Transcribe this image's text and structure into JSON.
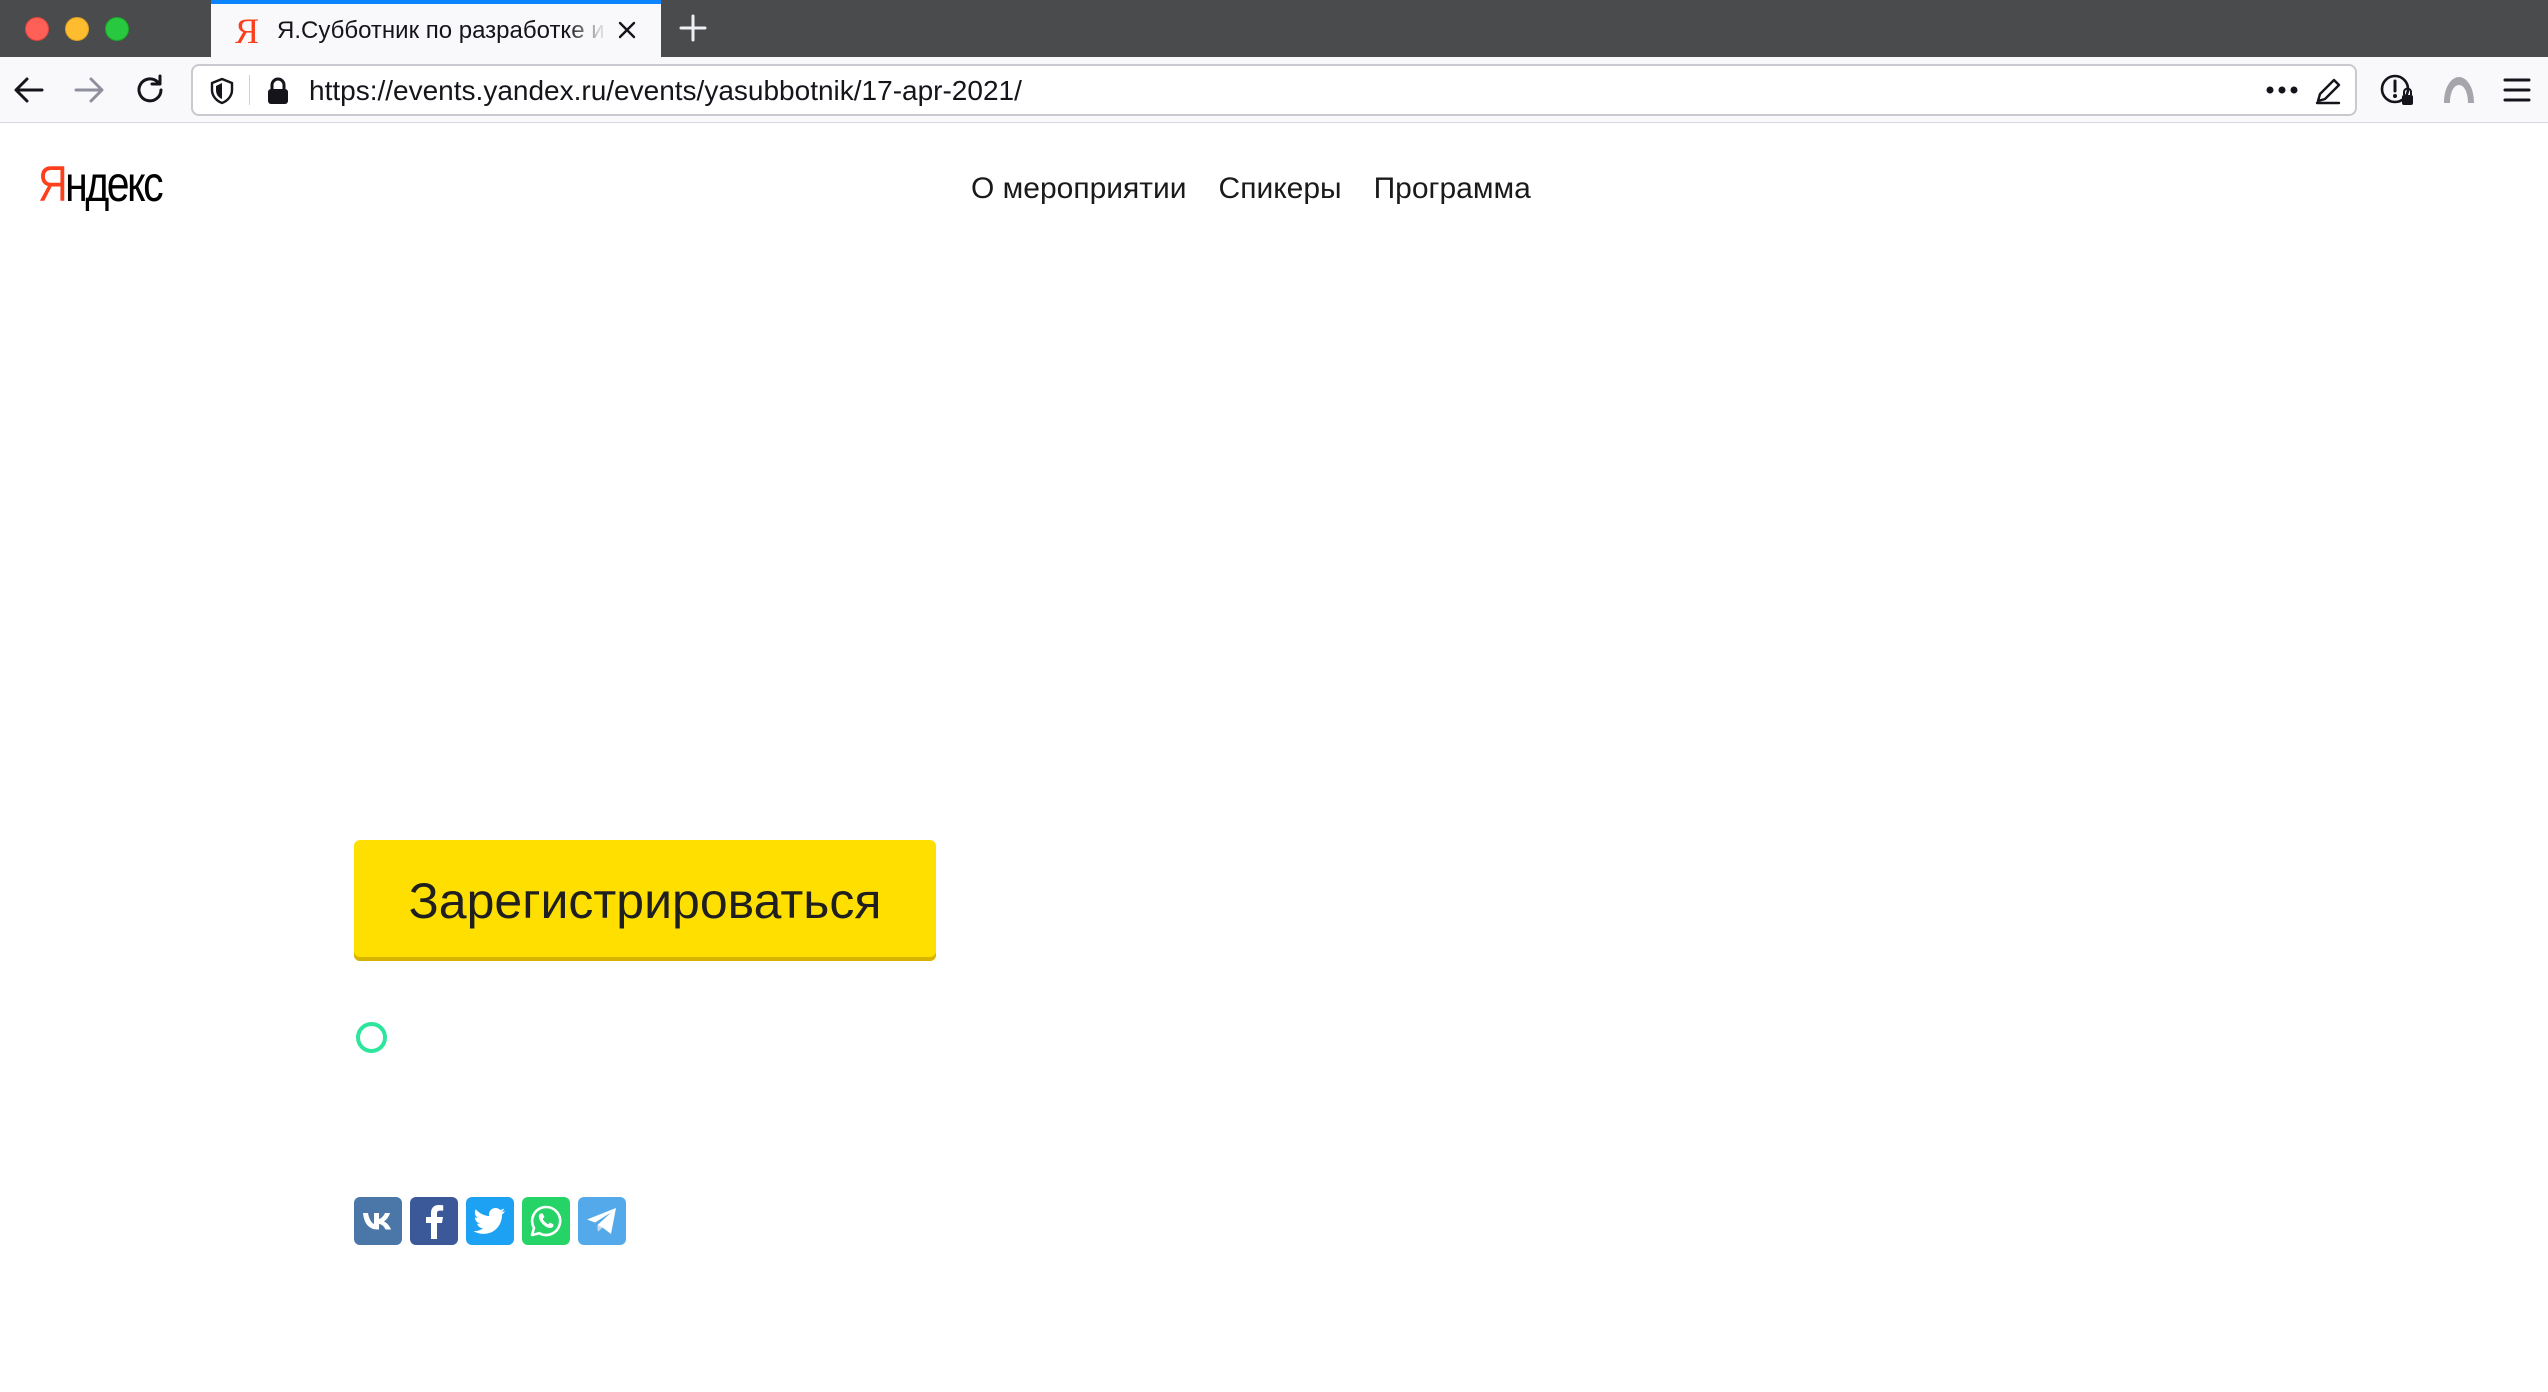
{
  "browser": {
    "tab": {
      "favicon": "Я",
      "title": "Я.Субботник по разработке интерфейсов"
    },
    "url": "https://events.yandex.ru/events/yasubbotnik/17-apr-2021/"
  },
  "site": {
    "logo": {
      "first_letter": "Я",
      "rest": "ндекс"
    },
    "nav": [
      {
        "label": "О мероприятии"
      },
      {
        "label": "Спикеры"
      },
      {
        "label": "Программа"
      }
    ]
  },
  "main": {
    "register_label": "Зарегистрироваться",
    "accent_color": "#ffdf00",
    "status_color": "#2ee59d"
  },
  "share": [
    {
      "icon": "vk-icon",
      "color": "#4a76a8"
    },
    {
      "icon": "facebook-icon",
      "color": "#3b5998"
    },
    {
      "icon": "twitter-icon",
      "color": "#1da1f2"
    },
    {
      "icon": "whatsapp-icon",
      "color": "#25d366"
    },
    {
      "icon": "telegram-icon",
      "color": "#54a9eb"
    }
  ]
}
